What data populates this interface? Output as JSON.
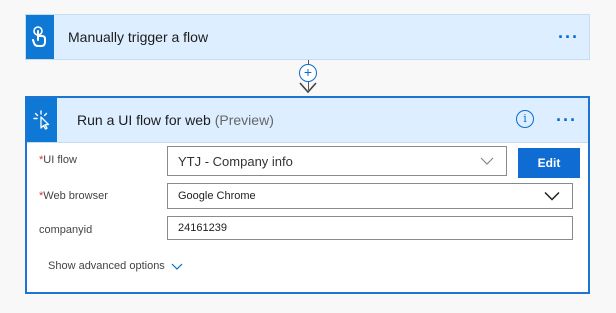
{
  "trigger": {
    "title": "Manually trigger a flow",
    "icon": "hand-touch-icon",
    "more": "···"
  },
  "connector": {
    "add": "+"
  },
  "action": {
    "title": "Run a UI flow for web",
    "preview": "(Preview)",
    "icon": "cursor-click-icon",
    "info": "i",
    "more": "···",
    "fields": {
      "ui_flow": {
        "required_mark": "*",
        "label": "UI flow",
        "value": "YTJ - Company info"
      },
      "web_browser": {
        "required_mark": "*",
        "label": "Web browser",
        "value": "Google Chrome"
      },
      "companyid": {
        "label": "companyid",
        "value": "24161239"
      }
    },
    "edit_label": "Edit",
    "advanced_label": "Show advanced options"
  },
  "colors": {
    "accent": "#0f78d4",
    "header_bg": "#dceeff",
    "required": "#d13438"
  }
}
